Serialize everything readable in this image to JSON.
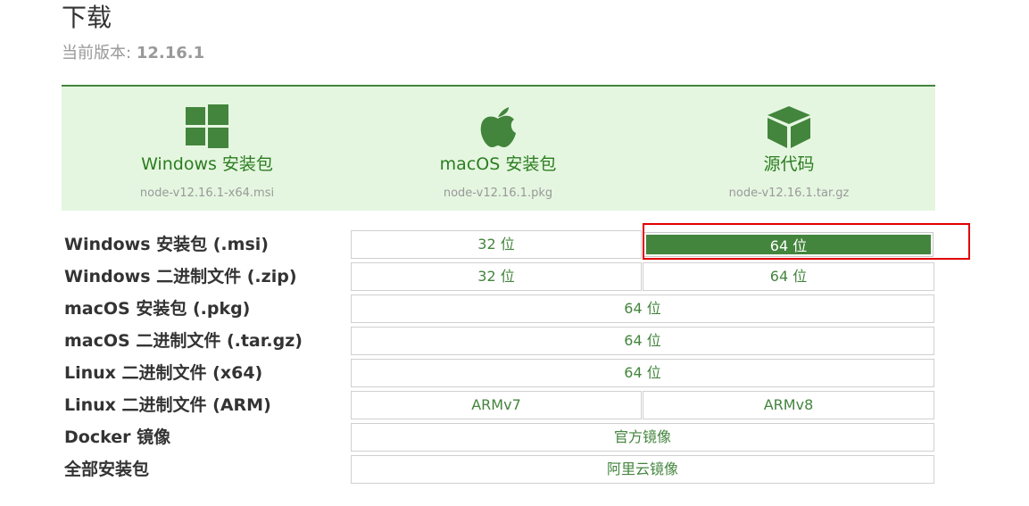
{
  "header": {
    "title": "下载",
    "version_label": "当前版本:",
    "version_value": "12.16.1"
  },
  "hero": [
    {
      "label": "Windows 安装包",
      "file": "node-v12.16.1-x64.msi",
      "icon": "windows-icon"
    },
    {
      "label": "macOS 安装包",
      "file": "node-v12.16.1.pkg",
      "icon": "apple-icon"
    },
    {
      "label": "源代码",
      "file": "node-v12.16.1.tar.gz",
      "icon": "cube-icon"
    }
  ],
  "rows": [
    {
      "label": "Windows 安装包 (.msi)",
      "buttons": [
        "32 位",
        "64 位"
      ]
    },
    {
      "label": "Windows 二进制文件 (.zip)",
      "buttons": [
        "32 位",
        "64 位"
      ]
    },
    {
      "label": "macOS 安装包 (.pkg)",
      "buttons": [
        "64 位"
      ]
    },
    {
      "label": "macOS 二进制文件 (.tar.gz)",
      "buttons": [
        "64 位"
      ]
    },
    {
      "label": "Linux 二进制文件 (x64)",
      "buttons": [
        "64 位"
      ]
    },
    {
      "label": "Linux 二进制文件 (ARM)",
      "buttons": [
        "ARMv7",
        "ARMv8"
      ]
    },
    {
      "label": "Docker 镜像",
      "buttons": [
        "官方镜像"
      ]
    },
    {
      "label": "全部安装包",
      "buttons": [
        "阿里云镜像"
      ]
    }
  ],
  "colors": {
    "brand_green": "#43853d",
    "hero_background": "#e5f6e0",
    "highlight_border": "#e00000"
  }
}
